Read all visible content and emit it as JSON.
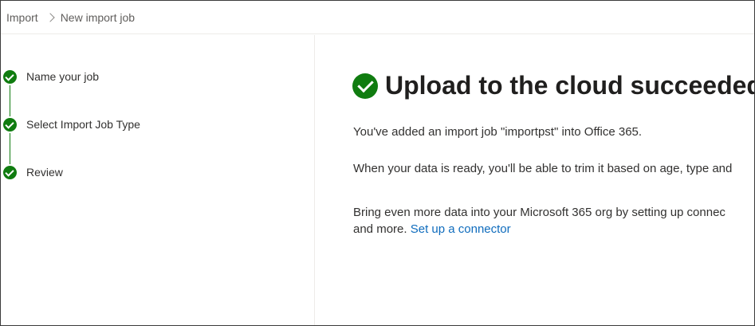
{
  "breadcrumb": {
    "root": "Import",
    "current": "New import job"
  },
  "steps": [
    {
      "label": "Name your job",
      "status": "completed"
    },
    {
      "label": "Select Import Job Type",
      "status": "completed"
    },
    {
      "label": "Review",
      "status": "completed"
    }
  ],
  "main": {
    "title": "Upload to the cloud succeeded",
    "line1": "You've added an import job \"importpst\" into Office 365.",
    "line2": "When your data is ready, you'll be able to trim it based on age, type and",
    "line3": "Bring even more data into your Microsoft 365 org by setting up connec",
    "line4_prefix": "and more.",
    "link_text": "Set up a connector"
  },
  "colors": {
    "success": "#107c10",
    "link": "#0f6cbd",
    "text": "#323130"
  },
  "icons": {
    "step_status": "check-circle-icon",
    "success": "check-circle-icon",
    "breadcrumb_separator": "chevron-right-icon"
  }
}
